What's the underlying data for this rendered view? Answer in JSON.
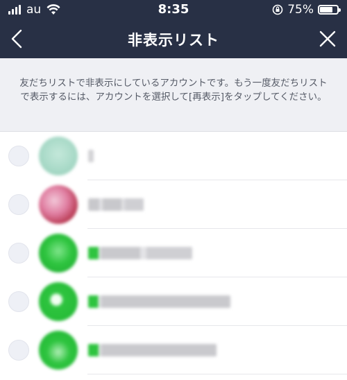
{
  "status": {
    "carrier": "au",
    "time": "8:35",
    "battery_percent": "75%",
    "battery_level": 0.75
  },
  "nav": {
    "title": "非表示リスト",
    "back_icon": "chevron-left-icon",
    "close_icon": "close-icon"
  },
  "notice": {
    "text": "友だちリストで非表示にしているアカウントです。もう一度友だちリストで表示するには、アカウントを選択して[再表示]をタップしてください。"
  },
  "colors": {
    "nav_bg": "#283045",
    "notice_bg": "#eff0f4",
    "line_green": "#2ac43a"
  },
  "accounts": [
    {
      "avatar_color": "#a9dac8",
      "name_obscured": true
    },
    {
      "avatar_color": "#e07fa2",
      "name_obscured": true
    },
    {
      "avatar_color": "#2ec43f",
      "name_obscured": true
    },
    {
      "avatar_color": "#2ec43f",
      "name_obscured": true
    },
    {
      "avatar_color": "#2ec43f",
      "name_obscured": true
    }
  ]
}
